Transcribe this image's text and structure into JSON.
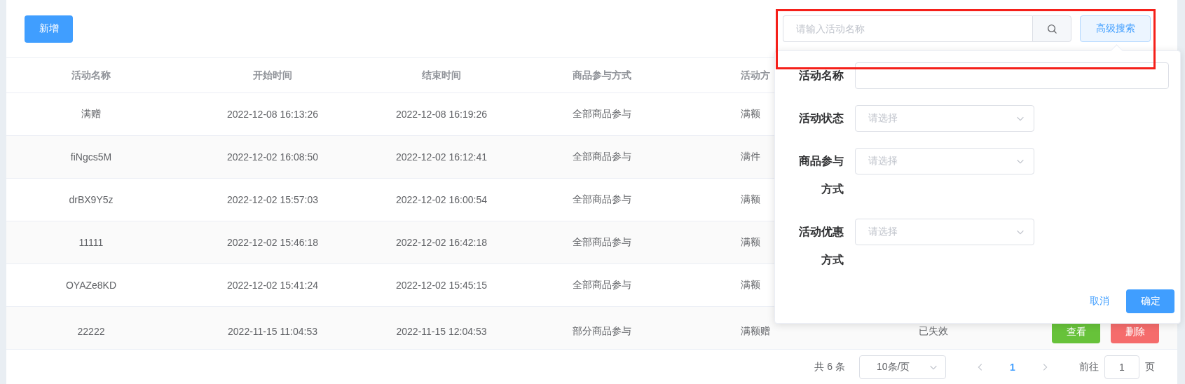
{
  "toolbar": {
    "add_button": "新增",
    "search": {
      "placeholder": "请输入活动名称"
    },
    "advanced_search_button": "高级搜索"
  },
  "table": {
    "columns": [
      "活动名称",
      "开始时间",
      "结束时间",
      "商品参与方式",
      "活动方"
    ],
    "rows": [
      {
        "cells": [
          "满赠",
          "2022-12-08 16:13:26",
          "2022-12-08 16:19:26",
          "全部商品参与",
          "满额"
        ]
      },
      {
        "cells": [
          "fiNgcs5M",
          "2022-12-02 16:08:50",
          "2022-12-02 16:12:41",
          "全部商品参与",
          "满件"
        ]
      },
      {
        "cells": [
          "drBX9Y5z",
          "2022-12-02 15:57:03",
          "2022-12-02 16:00:54",
          "全部商品参与",
          "满额"
        ]
      },
      {
        "cells": [
          "11111",
          "2022-12-02 15:46:18",
          "2022-12-02 16:42:18",
          "全部商品参与",
          "满额"
        ]
      },
      {
        "cells": [
          "OYAZe8KD",
          "2022-12-02 15:41:24",
          "2022-12-02 15:45:15",
          "全部商品参与",
          "满额"
        ]
      },
      {
        "cells": [
          "22222",
          "2022-11-15 11:04:53",
          "2022-11-15 12:04:53",
          "部分商品参与",
          "满额赠"
        ],
        "status": "已失效",
        "actions": [
          "查看",
          "删除"
        ]
      }
    ]
  },
  "pagination": {
    "total": "共 6 条",
    "page_size": "10条/页",
    "pages": [
      {
        "label": "1",
        "selected": true
      }
    ],
    "goto_label": "前往",
    "goto_value": "1",
    "goto_suffix": "页"
  },
  "advanced_search": {
    "fields": [
      {
        "label": "活动名称",
        "kind": "input"
      },
      {
        "label": "活动状态",
        "kind": "select",
        "placeholder": "请选择"
      },
      {
        "label": "商品参与方式",
        "kind": "select",
        "placeholder": "请选择"
      },
      {
        "label": "活动优惠方式",
        "kind": "select",
        "placeholder": "请选择"
      }
    ],
    "cancel": "取消",
    "confirm": "确定"
  },
  "highlight_box": true
}
